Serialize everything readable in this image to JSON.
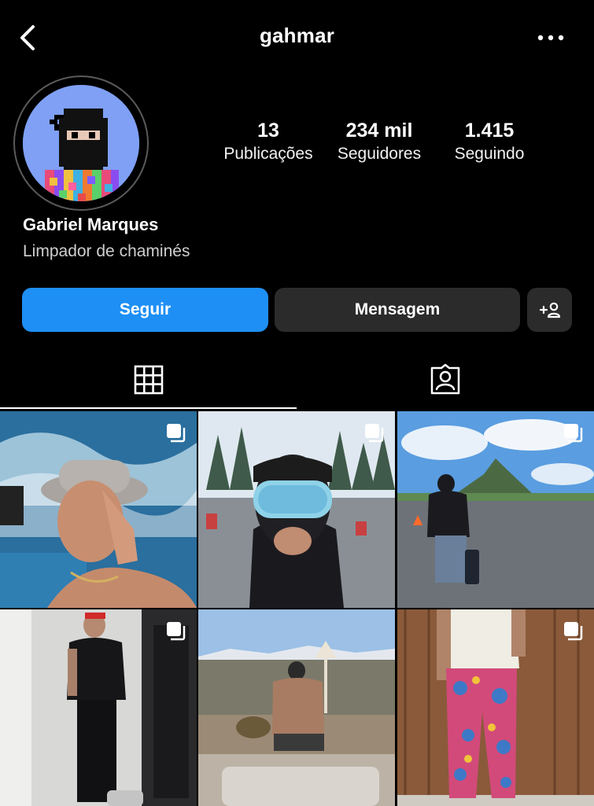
{
  "header": {
    "username": "gahmar"
  },
  "profile": {
    "avatar_icon": "pixel-ninja-avatar",
    "stats": [
      {
        "value": "13",
        "label": "Publicações"
      },
      {
        "value": "234 mil",
        "label": "Seguidores"
      },
      {
        "value": "1.415",
        "label": "Seguindo"
      }
    ],
    "name": "Gabriel Marques",
    "bio": "Limpador de chaminés"
  },
  "actions": {
    "follow_label": "Seguir",
    "message_label": "Mensagem",
    "suggest_icon": "add-person-icon"
  },
  "tabs": [
    {
      "icon": "grid-icon",
      "selected": true
    },
    {
      "icon": "tagged-person-icon",
      "selected": false
    }
  ],
  "posts": [
    {
      "icon": "multi-photo-icon"
    },
    {
      "icon": "multi-photo-icon"
    },
    {
      "icon": "multi-photo-icon"
    },
    {
      "icon": "multi-photo-icon"
    },
    {
      "icon": "multi-photo-icon"
    },
    {
      "icon": "multi-photo-icon"
    }
  ],
  "colors": {
    "accent": "#1e8ff4",
    "secondary_button": "#2b2b2b",
    "background": "#000000"
  }
}
